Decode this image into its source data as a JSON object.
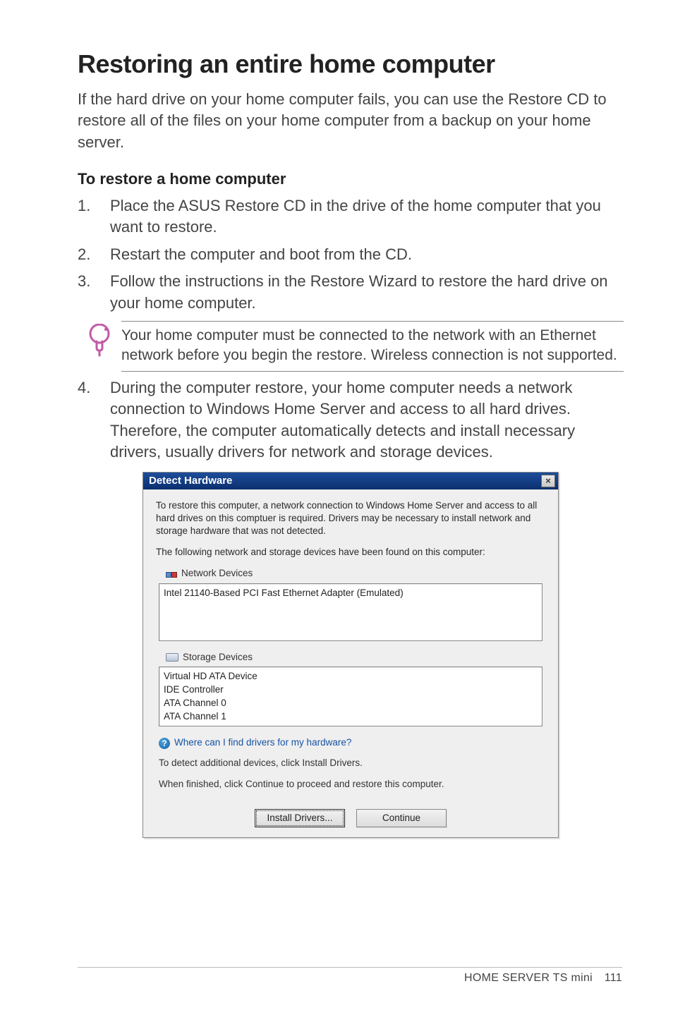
{
  "page_title": "Restoring an entire home computer",
  "intro": "If the hard drive on your home computer fails, you can use the Restore CD to restore all of the files on your home computer from a backup on your home server.",
  "subhead": "To restore a home computer",
  "steps": [
    "Place the ASUS Restore CD in the drive of the home computer that you want to restore.",
    "Restart the computer and boot from the CD.",
    "Follow the instructions in the Restore Wizard to restore the hard drive on your home computer."
  ],
  "note": "Your home computer must be connected to the network with an Ethernet network before you begin the restore. Wireless connection is not supported.",
  "step4": "During the computer restore, your home computer needs a network connection to Windows Home Server and access to all hard drives. Therefore, the computer automatically detects and install necessary drivers, usually drivers for network and storage devices.",
  "dialog": {
    "title": "Detect Hardware",
    "close_glyph": "×",
    "para1": "To restore this computer, a network connection to Windows Home Server and access to all hard drives on this comptuer is required. Drivers may be necessary to install network and storage hardware that was not detected.",
    "para2": "The following network and storage devices have been found on this computer:",
    "network_label": "Network Devices",
    "network_items": [
      "Intel 21140-Based PCI Fast Ethernet Adapter (Emulated)"
    ],
    "storage_label": "Storage Devices",
    "storage_items": [
      "Virtual HD ATA Device",
      "IDE Controller",
      "ATA Channel 0",
      "ATA Channel 1"
    ],
    "help_glyph": "?",
    "help_link": "Where can I find drivers for my hardware?",
    "instr1": "To detect additional devices, click Install Drivers.",
    "instr2": "When finished, click Continue to proceed and restore this computer.",
    "install_btn": "Install Drivers...",
    "continue_btn": "Continue"
  },
  "footer": {
    "product": "HOME SERVER TS mini",
    "page_number": "111"
  }
}
